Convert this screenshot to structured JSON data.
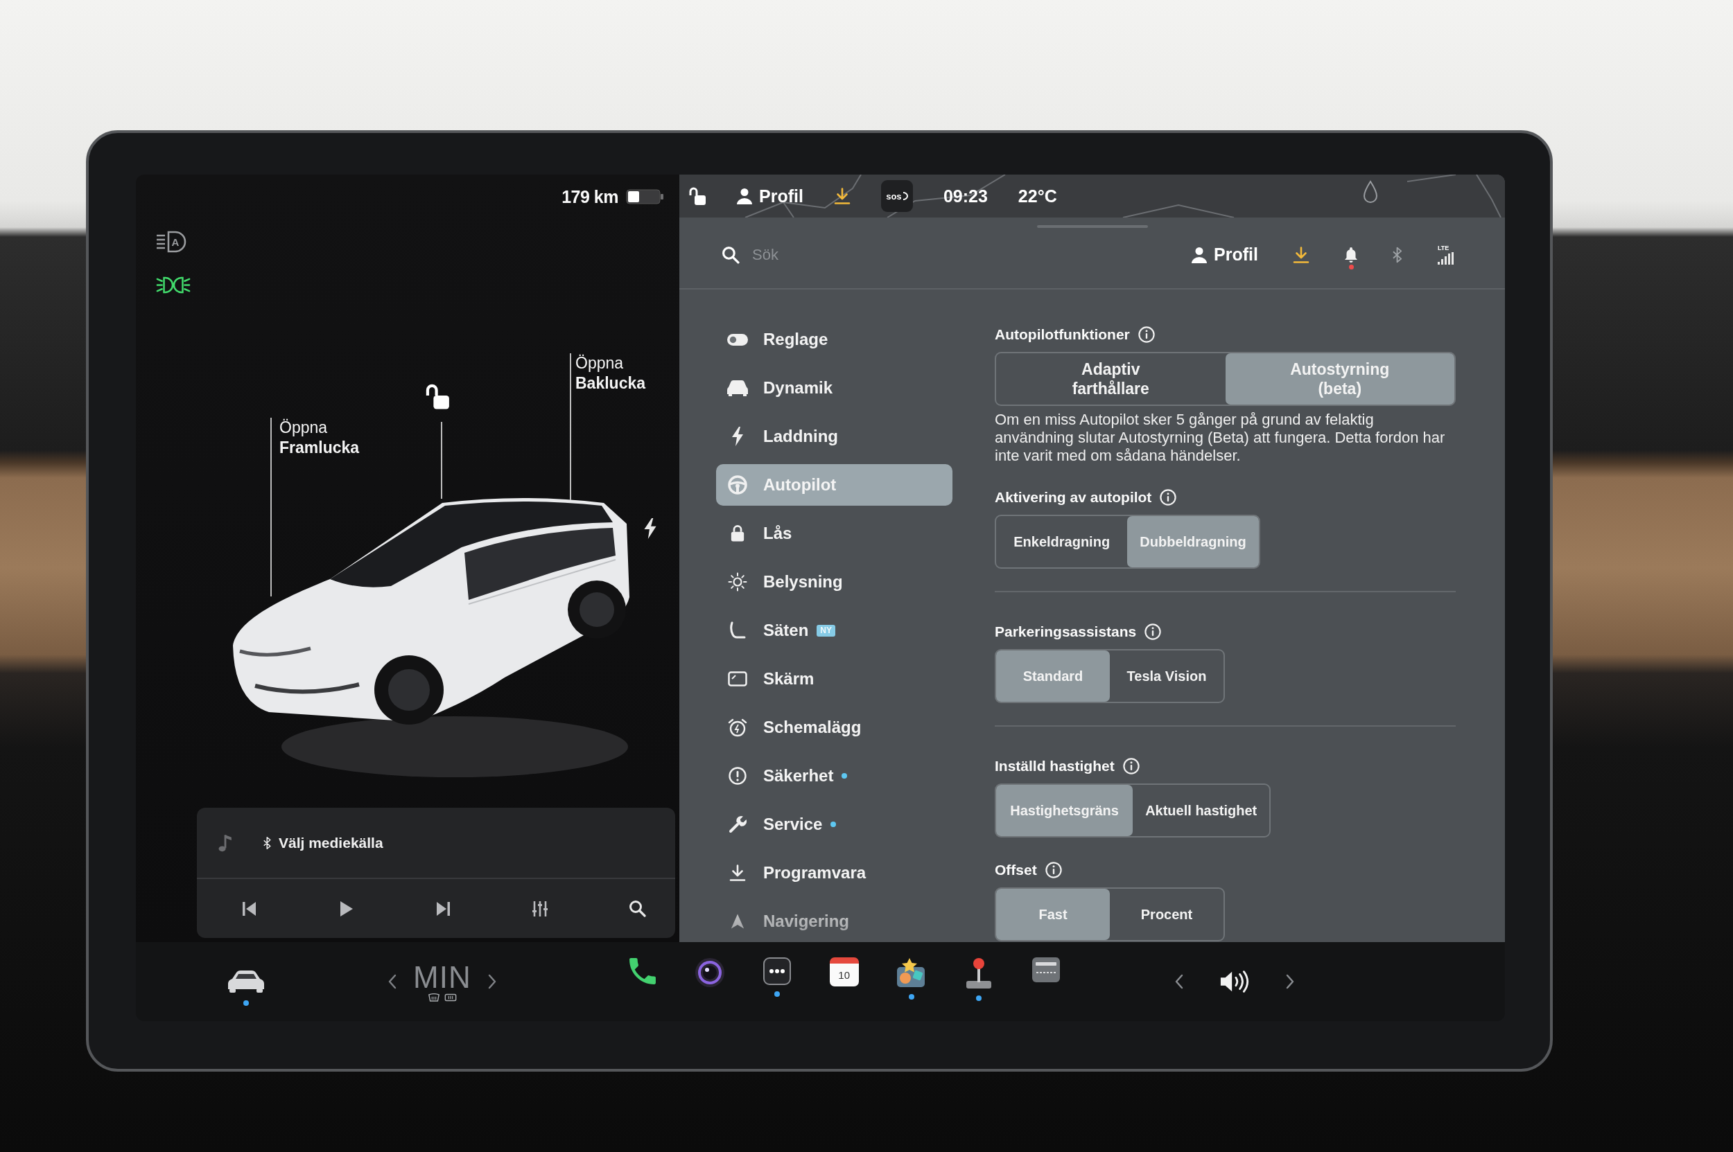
{
  "left_panel": {
    "range": "179 km",
    "lamp_indicators": [
      {
        "on": false,
        "mark": "A"
      },
      {
        "on": true
      }
    ],
    "car": {
      "callouts": [
        "Öppna\n**Framlucka**",
        "Öppna\n**Baklucka**"
      ],
      "locked": false
    },
    "media": {
      "source": "Välj mediekälla"
    }
  },
  "status_bar": {
    "items": [
      {
        "kind": "lock",
        "locked": false
      },
      {
        "kind": "profile",
        "label": "Profil"
      },
      {
        "kind": "download"
      },
      {
        "kind": "sos",
        "label": "sos"
      },
      {
        "kind": "text",
        "label": "09:23"
      },
      {
        "kind": "text",
        "label": "22°C"
      }
    ]
  },
  "search": {
    "placeholder": "Sök"
  },
  "header_icons": [
    {
      "kind": "profile",
      "label": "Profil"
    },
    {
      "kind": "download"
    },
    {
      "kind": "bell",
      "unread": true
    },
    {
      "kind": "bluetooth"
    },
    {
      "kind": "signal",
      "label": "LTE"
    }
  ],
  "settings_menu": {
    "items": [
      {
        "label": "Reglage",
        "selected": false,
        "notification": false
      },
      {
        "label": "Dynamik",
        "selected": false,
        "notification": false
      },
      {
        "label": "Laddning",
        "selected": false,
        "notification": false
      },
      {
        "label": "Autopilot",
        "selected": true,
        "notification": false
      },
      {
        "label": "Lås",
        "selected": false,
        "notification": false
      },
      {
        "label": "Belysning",
        "selected": false,
        "notification": false
      },
      {
        "label": "Säten",
        "selected": false,
        "notification": false,
        "badge": "NY"
      },
      {
        "label": "Skärm",
        "selected": false,
        "notification": false
      },
      {
        "label": "Schemalägg",
        "selected": false,
        "notification": false
      },
      {
        "label": "Säkerhet",
        "selected": false,
        "notification": true
      },
      {
        "label": "Service",
        "selected": false,
        "notification": true
      },
      {
        "label": "Programvara",
        "selected": false,
        "notification": false
      },
      {
        "label": "Navigering",
        "selected": false,
        "notification": false
      }
    ]
  },
  "settings": {
    "sections": [
      {
        "settings": [
          {
            "title": "Autopilotfunktioner",
            "options": [
              {
                "label": "Adaptiv\nfarthållare",
                "selected": false
              },
              {
                "label": "Autostyrning\n(beta)",
                "selected": true
              }
            ],
            "note": "Om en miss Autopilot sker 5 gånger på grund av felaktig användning slutar Autostyrning (Beta) att fungera. Detta fordon har inte varit med om sådana händelser."
          },
          {
            "title": "Aktivering av autopilot",
            "options": [
              {
                "label": "Enkeldragning",
                "selected": false
              },
              {
                "label": "Dubbeldragning",
                "selected": true
              }
            ]
          }
        ]
      },
      {
        "settings": [
          {
            "title": "Parkeringsassistans",
            "options": [
              {
                "label": "Standard",
                "selected": true
              },
              {
                "label": "Tesla Vision",
                "selected": false
              }
            ]
          }
        ]
      },
      {
        "settings": [
          {
            "title": "Inställd hastighet",
            "options": [
              {
                "label": "Hastighetsgräns",
                "selected": true
              },
              {
                "label": "Aktuell hastighet",
                "selected": false
              }
            ]
          },
          {
            "title": "Offset",
            "options": [
              {
                "label": "Fast",
                "selected": true
              },
              {
                "label": "Procent",
                "selected": false
              }
            ]
          }
        ]
      }
    ]
  },
  "taskbar": {
    "vehicle": {
      "running": true
    },
    "climate": "MIN",
    "apps": [
      {
        "kind": "phone",
        "running": false
      },
      {
        "kind": "camera",
        "running": false
      },
      {
        "kind": "more",
        "running": true
      },
      {
        "kind": "calendar",
        "label": "10",
        "running": false
      },
      {
        "kind": "toybox",
        "running": true
      },
      {
        "kind": "joystick",
        "running": true
      },
      {
        "kind": "viewer",
        "running": false
      }
    ]
  }
}
